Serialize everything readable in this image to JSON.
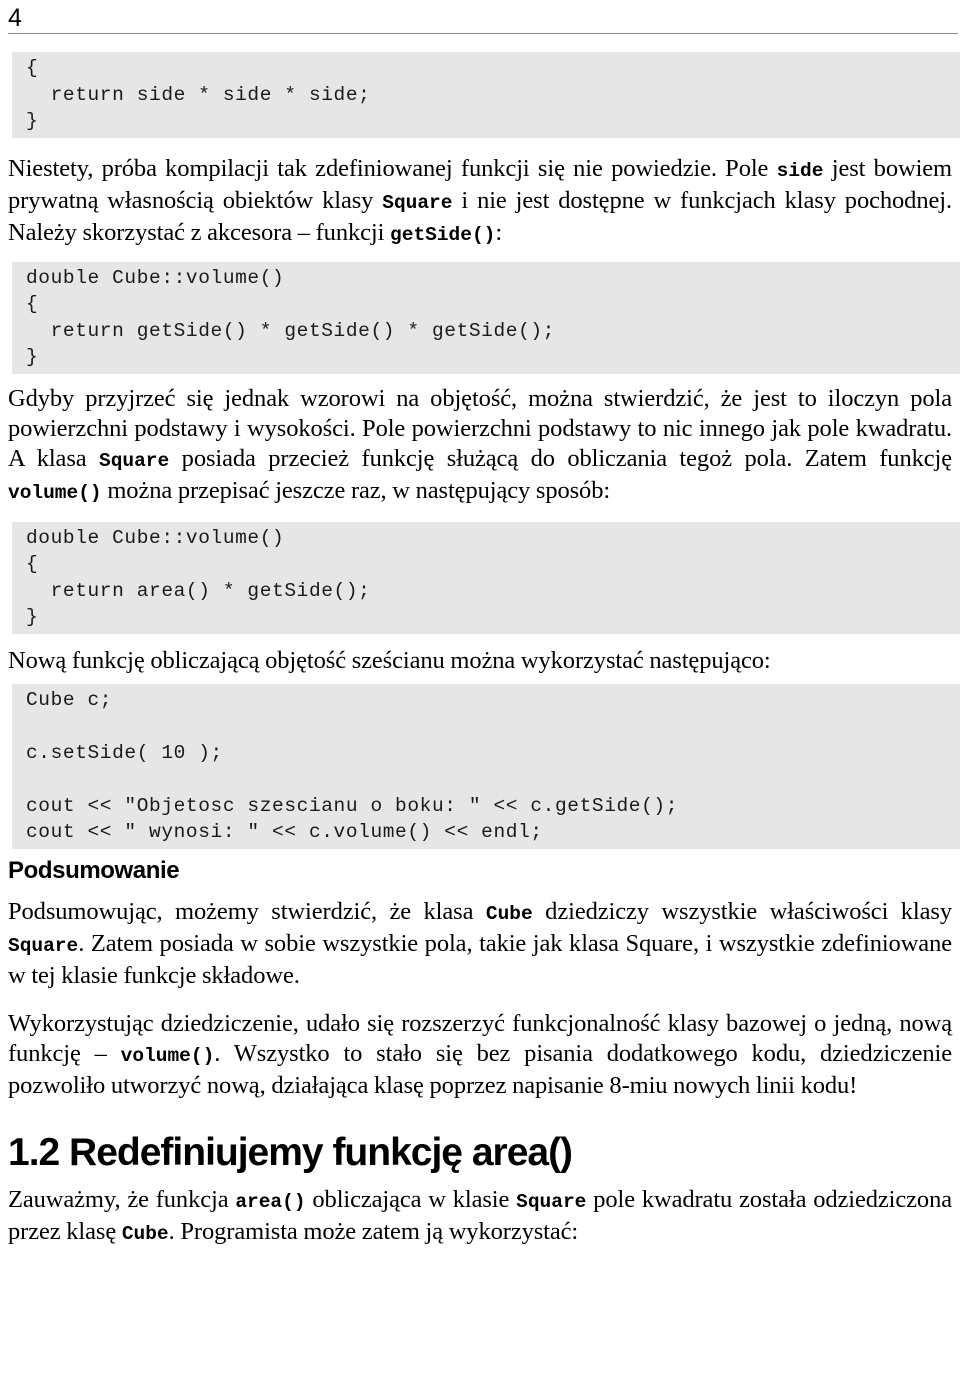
{
  "header": {
    "page_number": "4"
  },
  "blocks": {
    "code_1": {
      "lines": [
        "{",
        "  return side * side * side;",
        "}"
      ]
    },
    "para_1": {
      "segments": [
        {
          "type": "text",
          "value": "Niestety, próba kompilacji tak zdefiniowanej funkcji się nie powiedzie. Pole "
        },
        {
          "type": "code",
          "value": "side"
        },
        {
          "type": "text",
          "value": " jest bowiem prywatną własnością obiektów klasy "
        },
        {
          "type": "code",
          "value": "Square"
        },
        {
          "type": "text",
          "value": " i nie jest dostępne w funkcjach klasy pochodnej. Należy skorzystać z akcesora – funkcji "
        },
        {
          "type": "code",
          "value": "getSide()"
        },
        {
          "type": "text",
          "value": ":"
        }
      ]
    },
    "code_2": {
      "lines": [
        "double Cube::volume()",
        "{",
        "  return getSide() * getSide() * getSide();",
        "}"
      ]
    },
    "para_2": {
      "segments": [
        {
          "type": "text",
          "value": "Gdyby przyjrzeć się jednak wzorowi na objętość, można stwierdzić, że jest to iloczyn pola powierzchni podstawy i wysokości. Pole powierzchni podstawy to nic innego jak pole kwadratu. A klasa "
        },
        {
          "type": "code",
          "value": "Square"
        },
        {
          "type": "text",
          "value": " posiada przecież funkcję służącą do obliczania tegoż pola. Zatem funkcję "
        },
        {
          "type": "code",
          "value": "volume()"
        },
        {
          "type": "text",
          "value": " można przepisać jeszcze raz, w następujący sposób:"
        }
      ]
    },
    "code_3": {
      "lines": [
        "double Cube::volume()",
        "{",
        "  return area() * getSide();",
        "}"
      ]
    },
    "para_3": {
      "segments": [
        {
          "type": "text",
          "value": "Nową funkcję obliczającą objętość sześcianu można wykorzystać następująco:"
        }
      ]
    },
    "code_4": {
      "lines": [
        "Cube c;",
        "",
        "c.setSide( 10 );",
        "",
        "cout << \"Objetosc szescianu o boku: \" << c.getSide();",
        "cout << \" wynosi: \" << c.volume() << endl;"
      ]
    },
    "heading_summary": {
      "text": "Podsumowanie"
    },
    "para_4": {
      "segments": [
        {
          "type": "text",
          "value": "Podsumowując, możemy stwierdzić, że klasa "
        },
        {
          "type": "code",
          "value": "Cube"
        },
        {
          "type": "text",
          "value": " dziedziczy wszystkie właściwości klasy "
        },
        {
          "type": "code",
          "value": "Square"
        },
        {
          "type": "text",
          "value": ". Zatem posiada w sobie wszystkie pola, takie jak klasa Square, i wszystkie zdefiniowane w tej klasie funkcje składowe."
        }
      ]
    },
    "para_5": {
      "segments": [
        {
          "type": "text",
          "value": "Wykorzystując dziedziczenie, udało się rozszerzyć funkcjonalność klasy bazowej o jedną, nową funkcję – "
        },
        {
          "type": "code",
          "value": "volume()"
        },
        {
          "type": "text",
          "value": ". Wszystko to stało się bez pisania dodatkowego kodu, dziedziczenie pozwoliło utworzyć nową, działająca klasę poprzez napisanie 8-miu nowych linii kodu!"
        }
      ]
    },
    "heading_section": {
      "text": "1.2 Redefiniujemy funkcję area()"
    },
    "para_6": {
      "segments": [
        {
          "type": "text",
          "value": "Zauważmy, że funkcja "
        },
        {
          "type": "code",
          "value": "area()"
        },
        {
          "type": "text",
          "value": " obliczająca w klasie "
        },
        {
          "type": "code",
          "value": "Square"
        },
        {
          "type": "text",
          "value": " pole kwadratu została odziedziczona przez klasę "
        },
        {
          "type": "code",
          "value": "Cube"
        },
        {
          "type": "text",
          "value": ". Programista może zatem ją wykorzystać:"
        }
      ]
    }
  },
  "colors": {
    "code_background": "#e6e6e6",
    "rule": "#8a8a8a",
    "text": "#000000"
  }
}
